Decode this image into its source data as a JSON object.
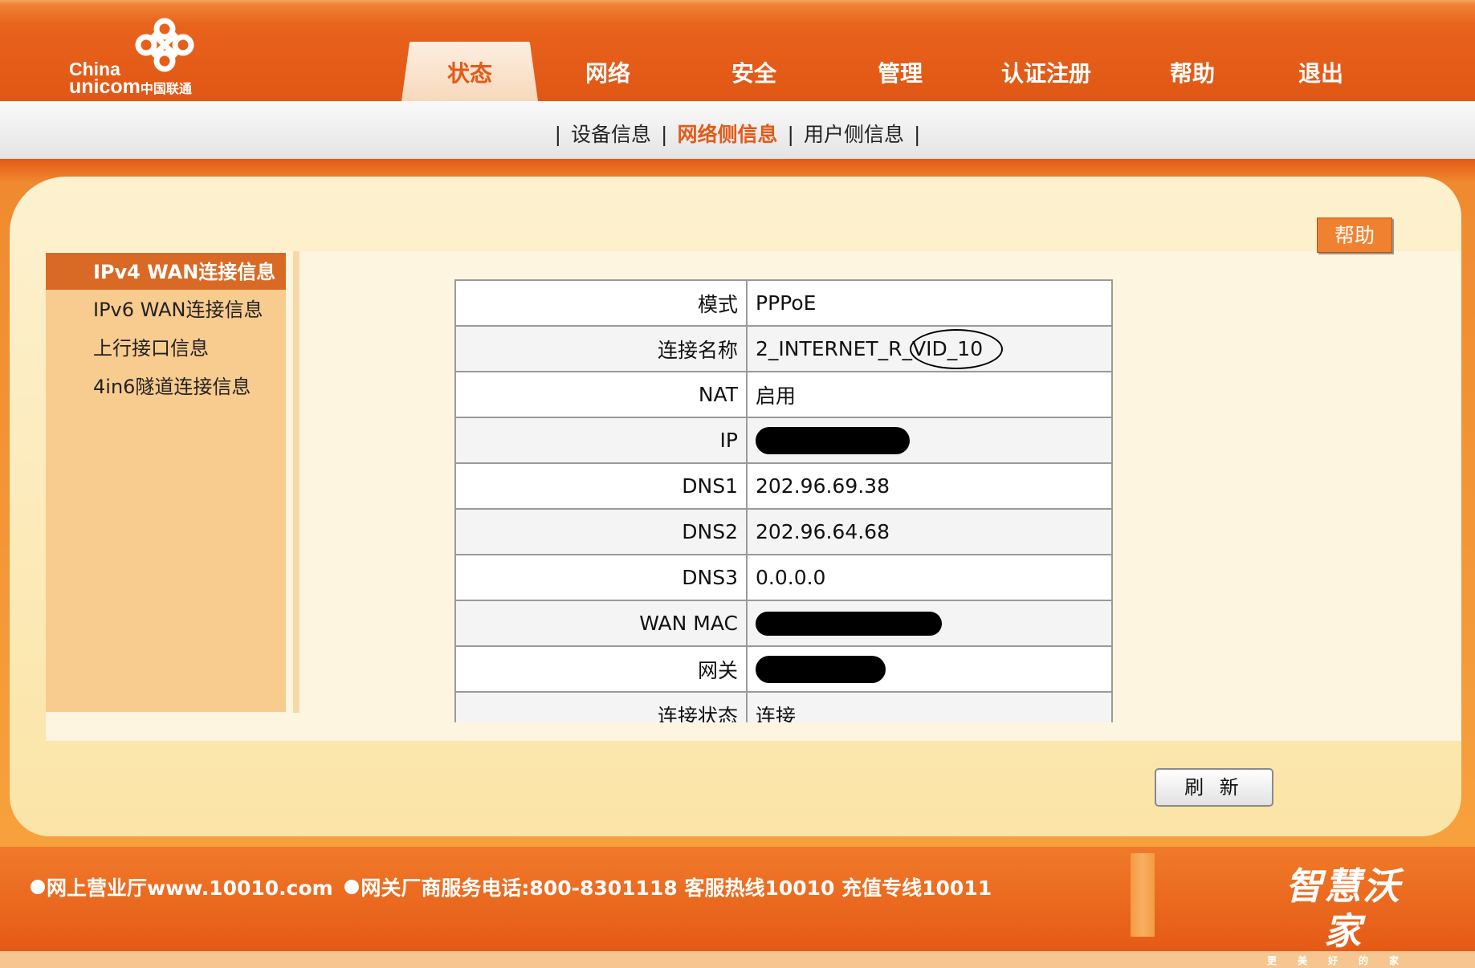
{
  "brand": {
    "logo_line1": "China",
    "logo_line2": "unicom",
    "logo_line2_cn": "中国联通"
  },
  "main_nav": [
    {
      "label": "状态",
      "active": true
    },
    {
      "label": "网络",
      "active": false
    },
    {
      "label": "安全",
      "active": false
    },
    {
      "label": "管理",
      "active": false
    },
    {
      "label": "认证注册",
      "active": false
    },
    {
      "label": "帮助",
      "active": false
    },
    {
      "label": "退出",
      "active": false
    }
  ],
  "sub_nav": {
    "separator": "|",
    "items": [
      {
        "label": "设备信息",
        "active": false
      },
      {
        "label": "网络侧信息",
        "active": true
      },
      {
        "label": "用户侧信息",
        "active": false
      }
    ]
  },
  "help_button": "帮助",
  "side_menu": [
    {
      "label": "IPv4 WAN连接信息",
      "active": true
    },
    {
      "label": "IPv6 WAN连接信息",
      "active": false
    },
    {
      "label": "上行接口信息",
      "active": false
    },
    {
      "label": "4in6隧道连接信息",
      "active": false
    }
  ],
  "info_table": [
    {
      "label": "模式",
      "value": "PPPoE"
    },
    {
      "label": "连接名称",
      "value": "2_INTERNET_R_VID_10"
    },
    {
      "label": "NAT",
      "value": "启用"
    },
    {
      "label": "IP",
      "value": ""
    },
    {
      "label": "DNS1",
      "value": "202.96.69.38"
    },
    {
      "label": "DNS2",
      "value": "202.96.64.68"
    },
    {
      "label": "DNS3",
      "value": "0.0.0.0"
    },
    {
      "label": "WAN MAC",
      "value": ""
    },
    {
      "label": "网关",
      "value": ""
    },
    {
      "label": "连接状态",
      "value": "连接"
    }
  ],
  "refresh_button": "刷 新",
  "footer": {
    "item1": "网上营业厅www.10010.com",
    "item2": "网关厂商服务电话:800-8301118 客服热线10010 充值专线10011",
    "brand_main": "智慧沃家",
    "brand_sub": "更美好的家"
  },
  "colors": {
    "header_orange": "#e15714",
    "active_text": "#e35a17",
    "side_active": "#d86a25",
    "side_bg": "#f8cb8e"
  }
}
